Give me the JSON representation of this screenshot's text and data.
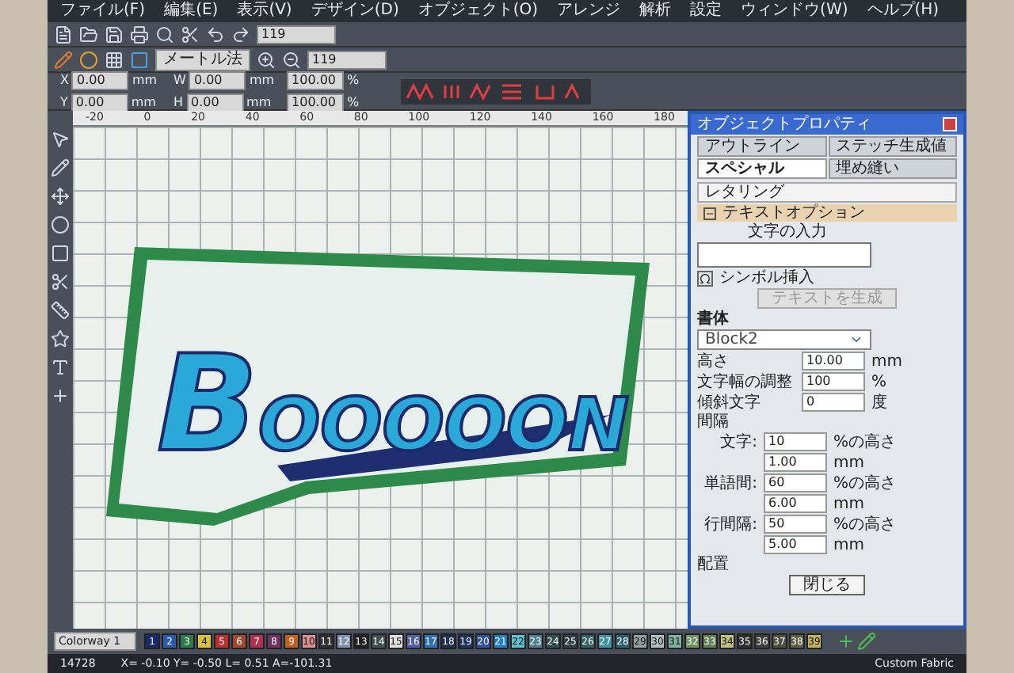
{
  "menu": [
    "ファイル(F)",
    "編集(E)",
    "表示(V)",
    "デザイン(D)",
    "オブジェクト(O)",
    "アレンジ",
    "解析",
    "設定",
    "ウィンドウ(W)",
    "ヘルプ(H)"
  ],
  "toolbar": {
    "zoom_1": "119",
    "units": "メートル法",
    "zoom_2": "119"
  },
  "transform": [
    {
      "label": "X",
      "value": "0.00",
      "unit": "mm"
    },
    {
      "label": "W",
      "value": "0.00",
      "unit": "mm"
    },
    {
      "value": "100.00",
      "unit": "%"
    },
    {
      "label": "Y",
      "value": "0.00",
      "unit": "mm"
    },
    {
      "label": "H",
      "value": "0.00",
      "unit": "mm"
    },
    {
      "value": "100.00",
      "unit": "%"
    }
  ],
  "ruler": [
    "-20",
    "0",
    "20",
    "40",
    "60",
    "80",
    "100",
    "120",
    "140",
    "160",
    "180"
  ],
  "design": {
    "text": "BOOOOON"
  },
  "panel": {
    "title": "オブジェクトプロパティ",
    "tabs": [
      {
        "label": "アウトライン",
        "selected": false
      },
      {
        "label": "ステッチ生成値",
        "selected": false
      },
      {
        "label": "スペシャル",
        "selected": true
      },
      {
        "label": "埋め縫い",
        "selected": false
      }
    ],
    "object_type": "レタリング",
    "section": {
      "label": "テキストオプション",
      "expanded": true
    },
    "text_input_label": "文字の入力",
    "symbol_button": {
      "label": "シンボル挿入"
    },
    "generate_button": {
      "label": "テキストを生成",
      "disabled": true
    },
    "font_label": "書体",
    "font": "Block2",
    "height_label": "高さ",
    "height": {
      "value": "10.00",
      "unit": "mm"
    },
    "width_label": "文字幅の調整",
    "width": {
      "value": "100",
      "unit": "%"
    },
    "slant_label": "傾斜文字",
    "slant": {
      "value": "0",
      "unit": "度"
    },
    "spacing_label": "間隔",
    "spacing": [
      {
        "label": "文字:",
        "value": "10",
        "unit": "%の高さ"
      },
      {
        "value": "1.00",
        "unit": "mm"
      },
      {
        "label": "単語間:",
        "value": "60",
        "unit": "%の高さ"
      },
      {
        "value": "6.00",
        "unit": "mm"
      },
      {
        "label": "行間隔:",
        "value": "50",
        "unit": "%の高さ"
      },
      {
        "value": "5.00",
        "unit": "mm"
      }
    ],
    "align_label": "配置",
    "close_button": "閉じる"
  },
  "colorway": "Colorway 1",
  "swatches": [
    {
      "label": "1",
      "color": "#1a2a6a"
    },
    {
      "label": "2",
      "color": "#2a5aaa"
    },
    {
      "label": "3",
      "color": "#2a7a4a"
    },
    {
      "label": "4",
      "color": "#d8c040"
    },
    {
      "label": "5",
      "color": "#b83030"
    },
    {
      "label": "6",
      "color": "#a04830"
    },
    {
      "label": "7",
      "color": "#b03050"
    },
    {
      "label": "8",
      "color": "#703060"
    },
    {
      "label": "9",
      "color": "#c06020"
    },
    {
      "label": "10",
      "color": "#d89090"
    },
    {
      "label": "11",
      "color": "#303030"
    },
    {
      "label": "12",
      "color": "#8090b0"
    },
    {
      "label": "13",
      "color": "#202020"
    },
    {
      "label": "14",
      "color": "#405050"
    },
    {
      "label": "15",
      "color": "#e0e0e0"
    },
    {
      "label": "16",
      "color": "#5060a0"
    },
    {
      "label": "17",
      "color": "#3070b0"
    },
    {
      "label": "18",
      "color": "#203050"
    },
    {
      "label": "19",
      "color": "#203060"
    },
    {
      "label": "20",
      "color": "#3050a0"
    },
    {
      "label": "21",
      "color": "#2080c0"
    },
    {
      "label": "22",
      "color": "#60c0d0"
    },
    {
      "label": "23",
      "color": "#508090"
    },
    {
      "label": "24",
      "color": "#305050"
    },
    {
      "label": "25",
      "color": "#304040"
    },
    {
      "label": "26",
      "color": "#306060"
    },
    {
      "label": "27",
      "color": "#4090a0"
    },
    {
      "label": "28",
      "color": "#306070"
    },
    {
      "label": "29",
      "color": "#90a0a0"
    },
    {
      "label": "30",
      "color": "#b0c0c0"
    },
    {
      "label": "31",
      "color": "#80b0a0"
    },
    {
      "label": "32",
      "color": "#709060"
    },
    {
      "label": "33",
      "color": "#608050"
    },
    {
      "label": "34",
      "color": "#c0c080"
    },
    {
      "label": "35",
      "color": "#303030"
    },
    {
      "label": "36",
      "color": "#404040"
    },
    {
      "label": "37",
      "color": "#505040"
    },
    {
      "label": "38",
      "color": "#606040"
    },
    {
      "label": "39",
      "color": "#c0b060"
    }
  ],
  "status": {
    "count": "14728",
    "coords": "X= -0.10 Y= -0.50 L= 0.51 A=-101.31",
    "fabric": "Custom Fabric"
  }
}
